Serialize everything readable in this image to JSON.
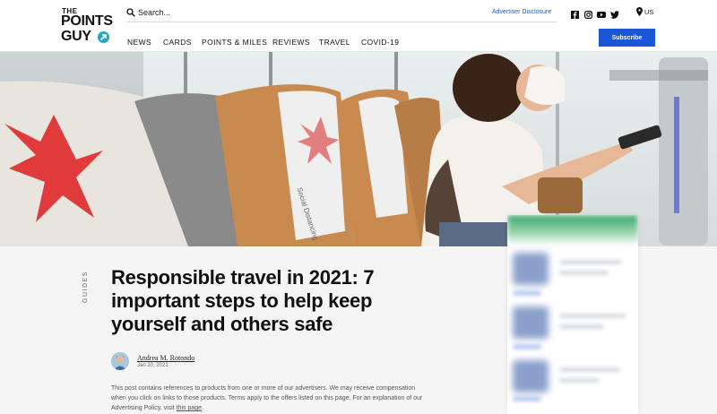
{
  "logo": {
    "line1": "THE",
    "line2": "POINTS",
    "line3": "GUY"
  },
  "search": {
    "placeholder": "Search..."
  },
  "header": {
    "advertiser_disclosure": "Advertiser Disclosure",
    "region": "US",
    "subscribe_label": "Subscribe",
    "socials": [
      "facebook-icon",
      "instagram-icon",
      "youtube-icon",
      "twitter-icon"
    ]
  },
  "nav": {
    "items": [
      {
        "label": "NEWS"
      },
      {
        "label": "CARDS"
      },
      {
        "label": "POINTS & MILES"
      },
      {
        "label": "REVIEWS"
      },
      {
        "label": "TRAVEL"
      },
      {
        "label": "COVID-19"
      }
    ]
  },
  "hero": {
    "seat_sign_text": "Social Distancing"
  },
  "article": {
    "category": "GUIDES",
    "title": "Responsible travel in 2021: 7 important steps to help keep yourself and others safe",
    "author": "Andrea M. Rotondo",
    "date": "Jan 20, 2021",
    "disclaimer_text": "This post contains references to products from one or more of our advertisers. We may receive compensation when you click on links to those products. Terms apply to the offers listed on this page. For an explanation of our Advertising Policy, visit ",
    "disclaimer_link": "this page",
    "disclaimer_end": "."
  },
  "colors": {
    "accent": "#1a56d6",
    "link": "#1f5fc4",
    "logo_badge": "#21a6c8",
    "seat": "#c98a4f",
    "cross": "#e03a3a"
  }
}
